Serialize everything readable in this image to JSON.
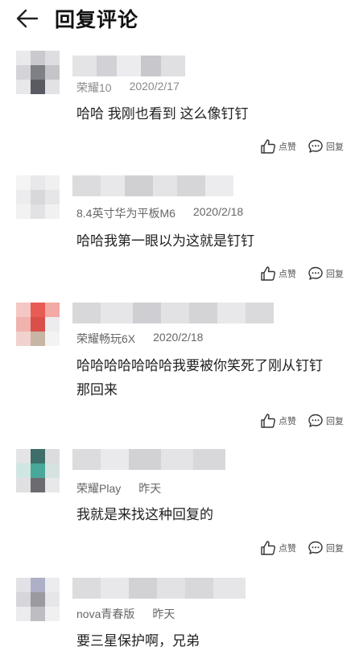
{
  "header": {
    "title": "回复评论",
    "back_icon": "arrow-left-icon"
  },
  "actions": {
    "like_label": "点赞",
    "reply_label": "回复",
    "like_icon": "thumbs-up-icon",
    "reply_icon": "chat-bubble-icon"
  },
  "comments": [
    {
      "device": "荣耀10",
      "date": "2020/2/17",
      "text": "哈哈 我刚也看到 这么像钉钉"
    },
    {
      "device": "8.4英寸华为平板M6",
      "date": "2020/2/18",
      "text": "哈哈我第一眼以为这就是钉钉"
    },
    {
      "device": "荣耀畅玩6X",
      "date": "2020/2/18",
      "text": "哈哈哈哈哈哈哈我要被你笑死了刚从钉钉那回来"
    },
    {
      "device": "荣耀Play",
      "date": "昨天",
      "text": "我就是来找这种回复的"
    },
    {
      "device": "nova青春版",
      "date": "昨天",
      "text": "要三星保护啊，兄弟"
    }
  ],
  "colors": {
    "meta_text": "#8a8a8a",
    "body_text": "#222222",
    "background": "#ffffff"
  }
}
